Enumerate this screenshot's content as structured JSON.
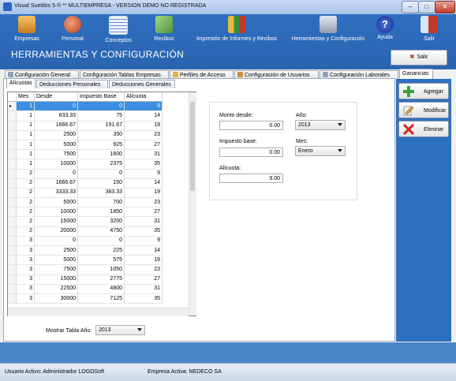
{
  "window": {
    "title": "Visual Sueldos 5 ®   ** MULTIEMPRESA -  VERSION DEMO NO REGISTRADA",
    "minimize": "–",
    "maximize": "□",
    "close": "✕"
  },
  "toolbar": {
    "items": [
      {
        "label": "Empresas",
        "icon": "buildings-icon",
        "color": "#e8a23a"
      },
      {
        "label": "Personal",
        "icon": "people-icon",
        "color": "#d8562f"
      },
      {
        "label": "Conceptos",
        "icon": "list-icon",
        "color": "#eef3fb"
      },
      {
        "label": "Recibos",
        "icon": "money-icon",
        "color": "#78b85a"
      },
      {
        "label": "Impresión de Informes y Recibos",
        "icon": "report-chart-icon",
        "color": "#e9b940"
      },
      {
        "label": "Herramientas y Configuración",
        "icon": "tools-icon",
        "color": "#b8c4d4"
      },
      {
        "label": "Ayuda",
        "icon": "help-icon",
        "color": "#2340a8"
      },
      {
        "label": "Salir",
        "icon": "exit-door-icon",
        "color": "#c0392b"
      }
    ]
  },
  "section_title": "HERRAMIENTAS Y CONFIGURACIÓN",
  "salir_button": "Salir",
  "tabs": [
    "Configuración General",
    "Configuración Tablas Empresas",
    "Perfiles de Acceso",
    "Configuración de Usuarios",
    "Configuración Laborales",
    "Ganancias"
  ],
  "subtabs": [
    "Alícuotas",
    "Deducciones Personales",
    "Deducciones Generales"
  ],
  "grid": {
    "columns": [
      "Mes",
      "Desde",
      "Impuesto Base",
      "Alícuota"
    ],
    "rows": [
      [
        "1",
        "0",
        "0",
        "9"
      ],
      [
        "1",
        "833.33",
        "75",
        "14"
      ],
      [
        "1",
        "1666.67",
        "191.67",
        "19"
      ],
      [
        "1",
        "2500",
        "350",
        "23"
      ],
      [
        "1",
        "5000",
        "925",
        "27"
      ],
      [
        "1",
        "7500",
        "1600",
        "31"
      ],
      [
        "1",
        "10000",
        "2375",
        "35"
      ],
      [
        "2",
        "0",
        "0",
        "9"
      ],
      [
        "2",
        "1666.67",
        "150",
        "14"
      ],
      [
        "2",
        "3333.33",
        "383.33",
        "19"
      ],
      [
        "2",
        "5000",
        "700",
        "23"
      ],
      [
        "2",
        "10000",
        "1850",
        "27"
      ],
      [
        "2",
        "15000",
        "3200",
        "31"
      ],
      [
        "2",
        "20000",
        "4750",
        "35"
      ],
      [
        "3",
        "0",
        "0",
        "9"
      ],
      [
        "3",
        "2500",
        "225",
        "14"
      ],
      [
        "3",
        "5000",
        "575",
        "19"
      ],
      [
        "3",
        "7500",
        "1050",
        "23"
      ],
      [
        "3",
        "15000",
        "2775",
        "27"
      ],
      [
        "3",
        "22500",
        "4800",
        "31"
      ],
      [
        "3",
        "30000",
        "7125",
        "35"
      ]
    ]
  },
  "show_table_year": {
    "label": "Mostrar Tabla Año:",
    "value": "2013"
  },
  "form": {
    "monto_desde_label": "Monto desde:",
    "monto_desde_value": "0.00",
    "impuesto_base_label": "Impuesto base:",
    "impuesto_base_value": "0.00",
    "alicuota_label": "Alícuota:",
    "alicuota_value": "9.00",
    "anio_label": "Año:",
    "anio_value": "2013",
    "mes_label": "Mes:",
    "mes_value": "Enero"
  },
  "actions": {
    "agregar": "Agregar",
    "modificar": "Modificar",
    "eliminar": "Eliminar"
  },
  "status": {
    "usuario": "Usuario Activo: Administrador LOGOSoft",
    "empresa": "Empresa Activa: NEDECO SA"
  },
  "colors": {
    "header_blue": "#2f6fbf",
    "selection": "#3d8ee0"
  }
}
